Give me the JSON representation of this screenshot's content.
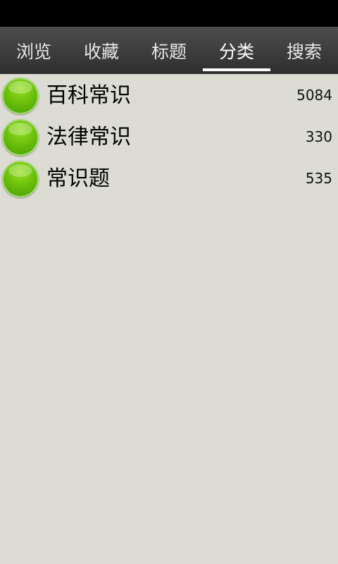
{
  "tabs": [
    {
      "label": "浏览"
    },
    {
      "label": "收藏"
    },
    {
      "label": "标题"
    },
    {
      "label": "分类"
    },
    {
      "label": "搜索"
    }
  ],
  "active_tab": "分类",
  "categories": [
    {
      "label": "百科常识",
      "count": "5084"
    },
    {
      "label": "法律常识",
      "count": "330"
    },
    {
      "label": "常识题",
      "count": "535"
    }
  ],
  "colors": {
    "status_bar": "#000000",
    "tab_bar": "#3a3a3a",
    "background": "#dcdcd5",
    "dot": "#6cc00c"
  },
  "icons": {
    "category_icon": "green-circle-icon"
  }
}
